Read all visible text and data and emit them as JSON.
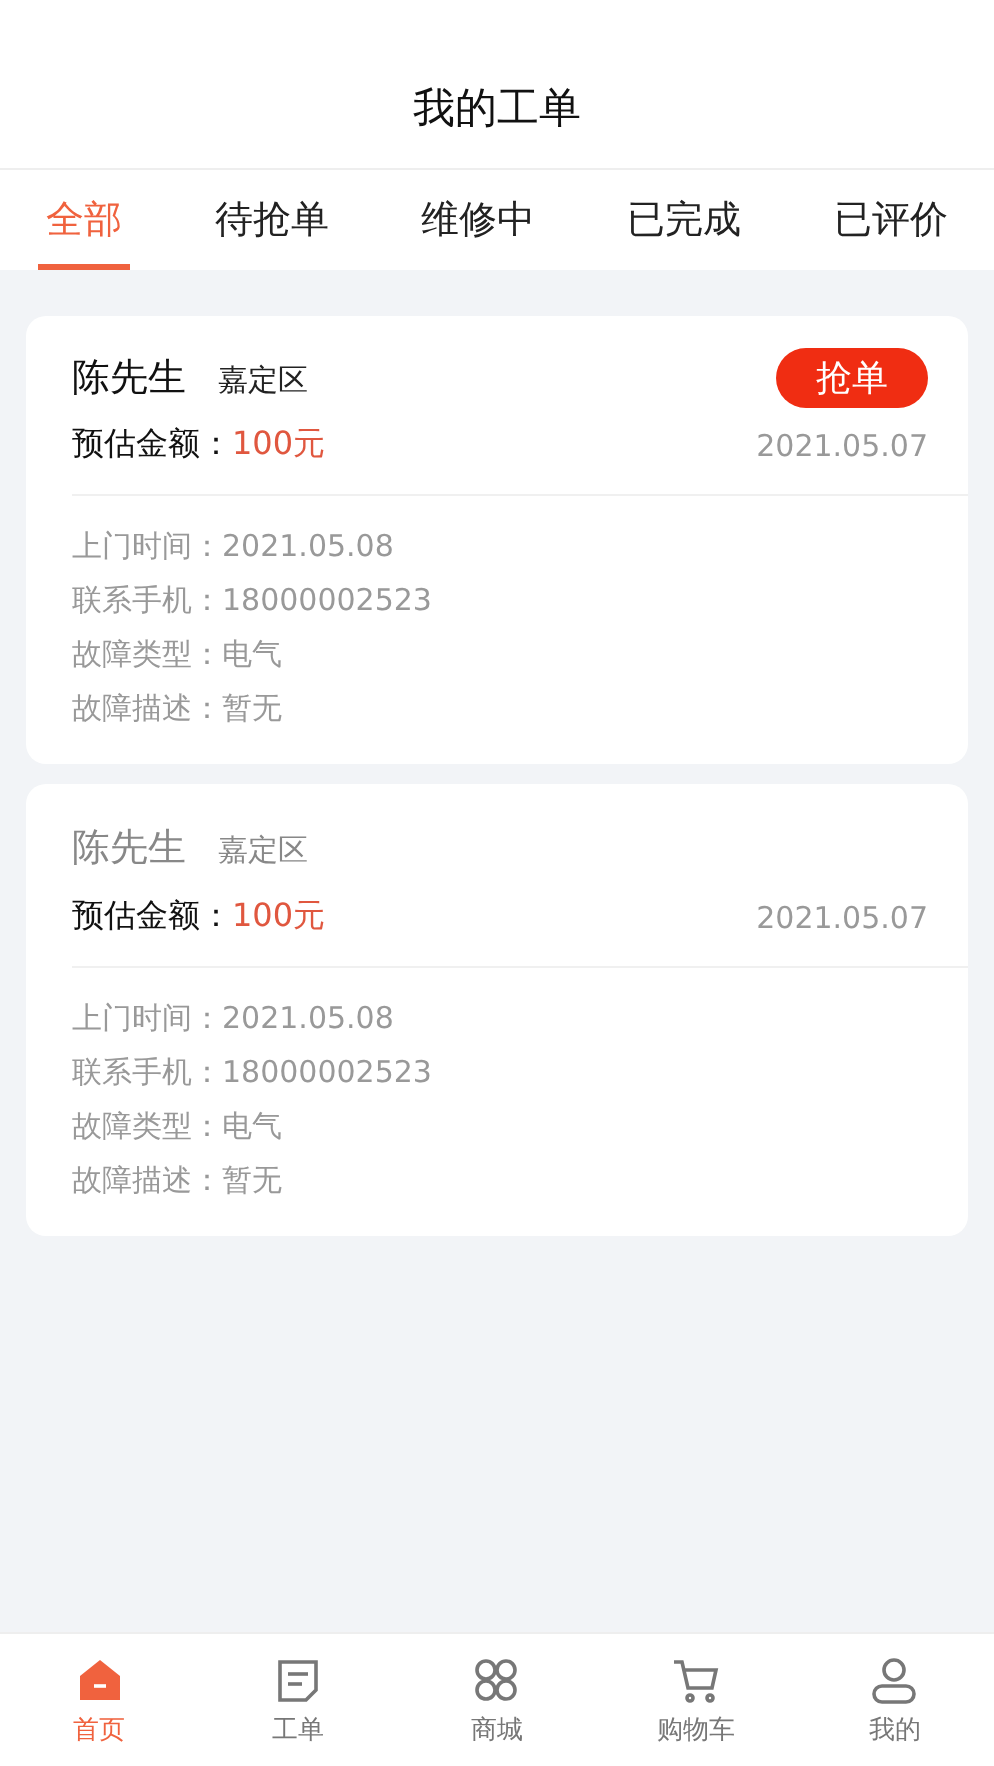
{
  "header": {
    "title": "我的工单"
  },
  "tabs": [
    {
      "label": "全部",
      "selected": true
    },
    {
      "label": "待抢单",
      "selected": false
    },
    {
      "label": "维修中",
      "selected": false
    },
    {
      "label": "已完成",
      "selected": false
    },
    {
      "label": "已评价",
      "selected": false
    }
  ],
  "orders": [
    {
      "name": "陈先生",
      "district": "嘉定区",
      "muted": false,
      "action": "抢单",
      "amount_label": "预估金额：",
      "amount": "100元",
      "date": "2021.05.07",
      "details": [
        "上门时间：2021.05.08",
        "联系手机：18000002523",
        "故障类型：电气",
        "故障描述：暂无"
      ]
    },
    {
      "name": "陈先生",
      "district": "嘉定区",
      "muted": true,
      "amount_label": "预估金额：",
      "amount": "100元",
      "date": "2021.05.07",
      "details": [
        "上门时间：2021.05.08",
        "联系手机：18000002523",
        "故障类型：电气",
        "故障描述：暂无"
      ]
    }
  ],
  "nav": [
    {
      "kind": "home",
      "label": "首页",
      "selected": true
    },
    {
      "kind": "orders",
      "label": "工单",
      "selected": false
    },
    {
      "kind": "shop",
      "label": "商城",
      "selected": false
    },
    {
      "kind": "cart",
      "label": "购物车",
      "selected": false
    },
    {
      "kind": "me",
      "label": "我的",
      "selected": false
    }
  ]
}
